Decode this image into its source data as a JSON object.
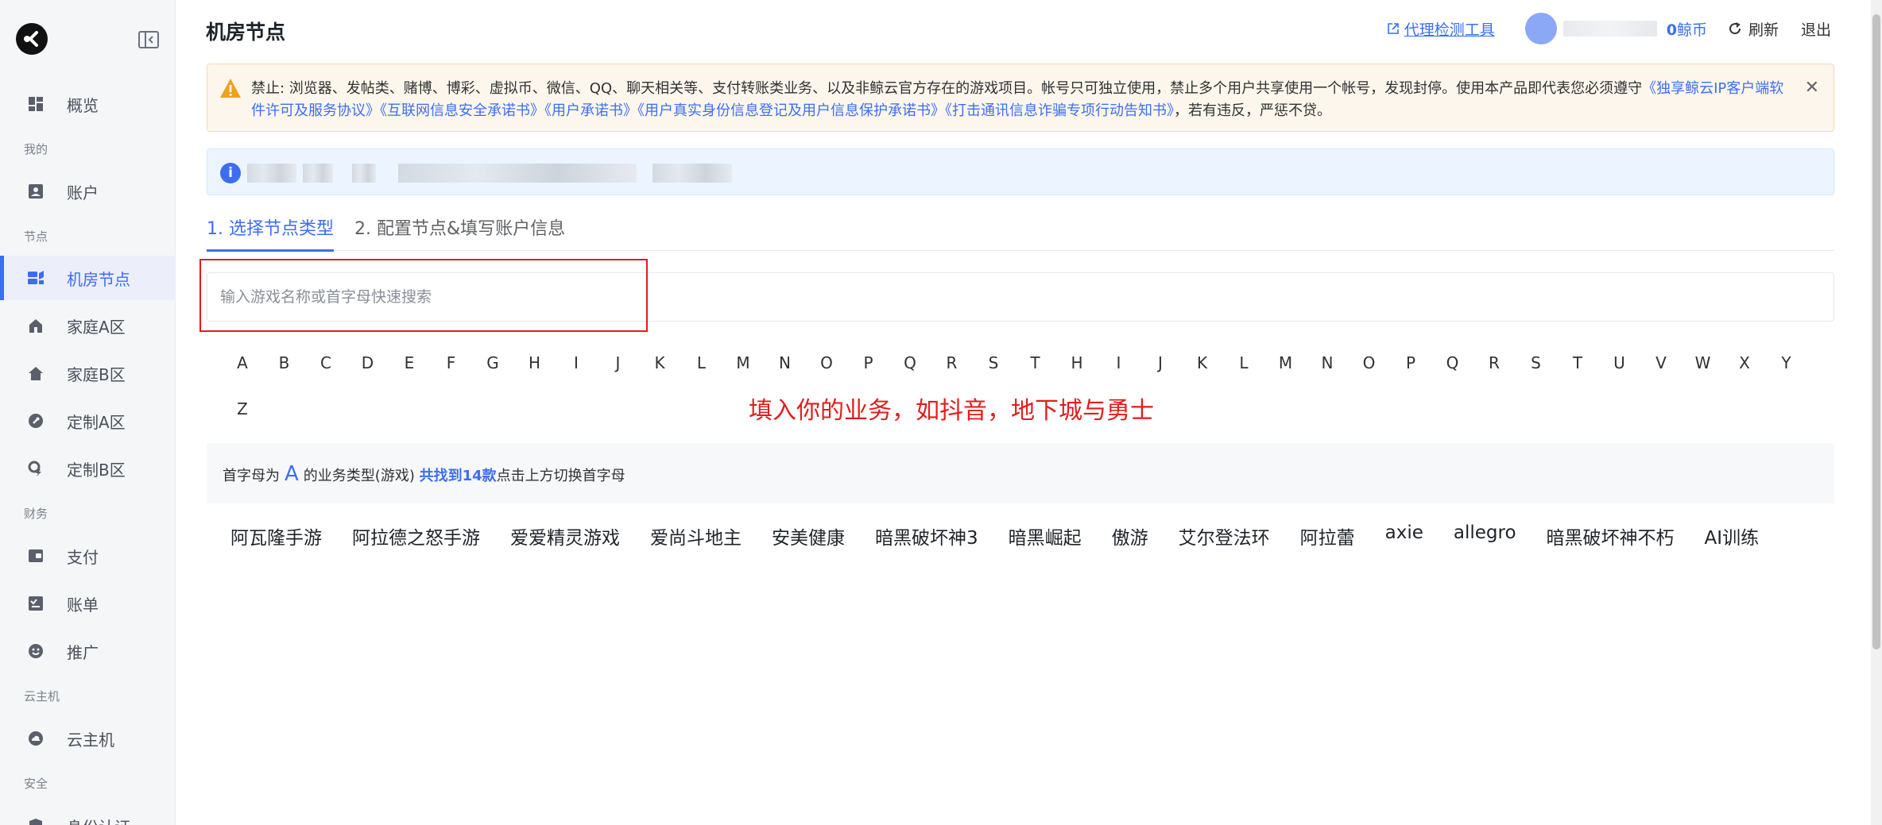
{
  "sidebar": {
    "items": [
      {
        "label": "概览",
        "icon": "dashboard-icon"
      },
      {
        "label": "账户",
        "icon": "account-icon"
      },
      {
        "label": "机房节点",
        "icon": "server-node-icon",
        "active": true
      },
      {
        "label": "家庭A区",
        "icon": "home-a-icon"
      },
      {
        "label": "家庭B区",
        "icon": "home-b-icon"
      },
      {
        "label": "定制A区",
        "icon": "wrench-icon"
      },
      {
        "label": "定制B区",
        "icon": "settings-lightning-icon"
      },
      {
        "label": "支付",
        "icon": "wallet-icon"
      },
      {
        "label": "账单",
        "icon": "bill-icon"
      },
      {
        "label": "推广",
        "icon": "smile-icon"
      },
      {
        "label": "云主机",
        "icon": "cloud-icon"
      },
      {
        "label": "身份认证",
        "icon": "shield-icon"
      }
    ],
    "sections": [
      "我的",
      "节点",
      "财务",
      "云主机",
      "安全"
    ]
  },
  "header": {
    "title": "机房节点",
    "proxy_tool": "代理检测工具",
    "coins_value": "0",
    "coins_unit": "鲸币",
    "refresh": "刷新",
    "logout": "退出"
  },
  "warning": {
    "prefix": "禁止: 浏览器、发帖类、赌博、博彩、虚拟币、微信、QQ、聊天相关等、支付转账类业务、以及非鲸云官方存在的游戏项目。帐号只可独立使用，禁止多个用户共享使用一个帐号，发现封停。使用本产品即代表您必须遵守",
    "link1": "《独享鲸云IP客户端软件许可及服务协议》",
    "link2": "《互联网信息安全承诺书》",
    "link3": "《用户承诺书》",
    "link4": "《用户真实身份信息登记及用户信息保护承诺书》",
    "link5": "《打击通讯信息诈骗专项行动告知书》",
    "suffix": "，若有违反，严惩不贷。"
  },
  "tabs": [
    {
      "label": "1. 选择节点类型",
      "active": true
    },
    {
      "label": "2. 配置节点&填写账户信息",
      "active": false
    }
  ],
  "search": {
    "placeholder": "输入游戏名称或首字母快速搜索"
  },
  "letters": [
    "A",
    "B",
    "C",
    "D",
    "E",
    "F",
    "G",
    "H",
    "I",
    "J",
    "K",
    "L",
    "M",
    "N",
    "O",
    "P",
    "Q",
    "R",
    "S",
    "T",
    "H",
    "I",
    "J",
    "K",
    "L",
    "M",
    "N",
    "O",
    "P",
    "Q",
    "R",
    "S",
    "T",
    "U",
    "V",
    "W",
    "X",
    "Y",
    "Z"
  ],
  "annotation": "填入你的业务，如抖音，地下城与勇士",
  "result": {
    "prefix": "首字母为",
    "letter": "A",
    "middle": "的业务类型(游戏)",
    "found": "共找到14款",
    "suffix": "点击上方切换首字母"
  },
  "games": [
    "阿瓦隆手游",
    "阿拉德之怒手游",
    "爱爱精灵游戏",
    "爱尚斗地主",
    "安美健康",
    "暗黑破坏神3",
    "暗黑崛起",
    "傲游",
    "艾尔登法环",
    "阿拉蕾",
    "axie",
    "allegro",
    "暗黑破坏神不朽",
    "AI训练"
  ],
  "colors": {
    "accent": "#3d6ef2",
    "warning_bg": "#fdf6ec",
    "info_bg": "#ecf5ff",
    "annotation_red": "#e21d1d"
  }
}
